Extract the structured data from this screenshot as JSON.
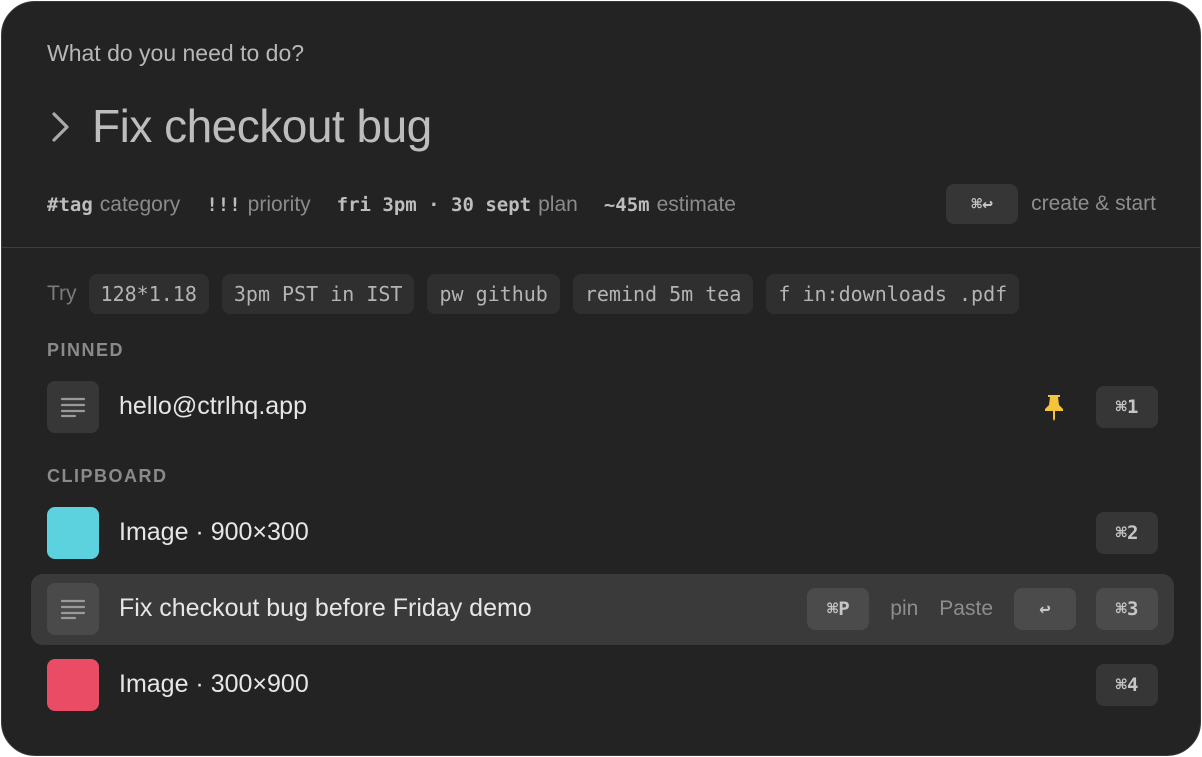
{
  "header": {
    "prompt": "What do you need to do?",
    "title": "Fix checkout bug"
  },
  "hints": [
    {
      "code": "#tag",
      "word": "category"
    },
    {
      "code": "!!!",
      "word": "priority"
    },
    {
      "code": "fri 3pm · 30 sept",
      "word": "plan"
    },
    {
      "code": "~45m",
      "word": "estimate"
    }
  ],
  "create": {
    "shortcut": "⌘↩",
    "label": "create & start"
  },
  "try": {
    "label": "Try",
    "chips": [
      "128*1.18",
      "3pm PST in IST",
      "pw github",
      "remind 5m tea",
      "f in:downloads .pdf"
    ]
  },
  "sections": {
    "pinned": "PINNED",
    "clipboard": "CLIPBOARD"
  },
  "pinned": [
    {
      "label": "hello@ctrlhq.app",
      "shortcut": "⌘1",
      "icon": "pin-icon",
      "pin_color": "#f5c43b"
    }
  ],
  "clipboard": [
    {
      "label": "Image · 900×300",
      "shortcut": "⌘2",
      "swatch": "#5bd2de"
    },
    {
      "label": "Fix checkout bug before Friday demo",
      "shortcut": "⌘3",
      "pin_shortcut": "⌘P",
      "pin_label": "pin",
      "paste_label": "Paste",
      "paste_key": "↩"
    },
    {
      "label": "Image · 300×900",
      "shortcut": "⌘4",
      "swatch": "#ea4c65"
    }
  ]
}
